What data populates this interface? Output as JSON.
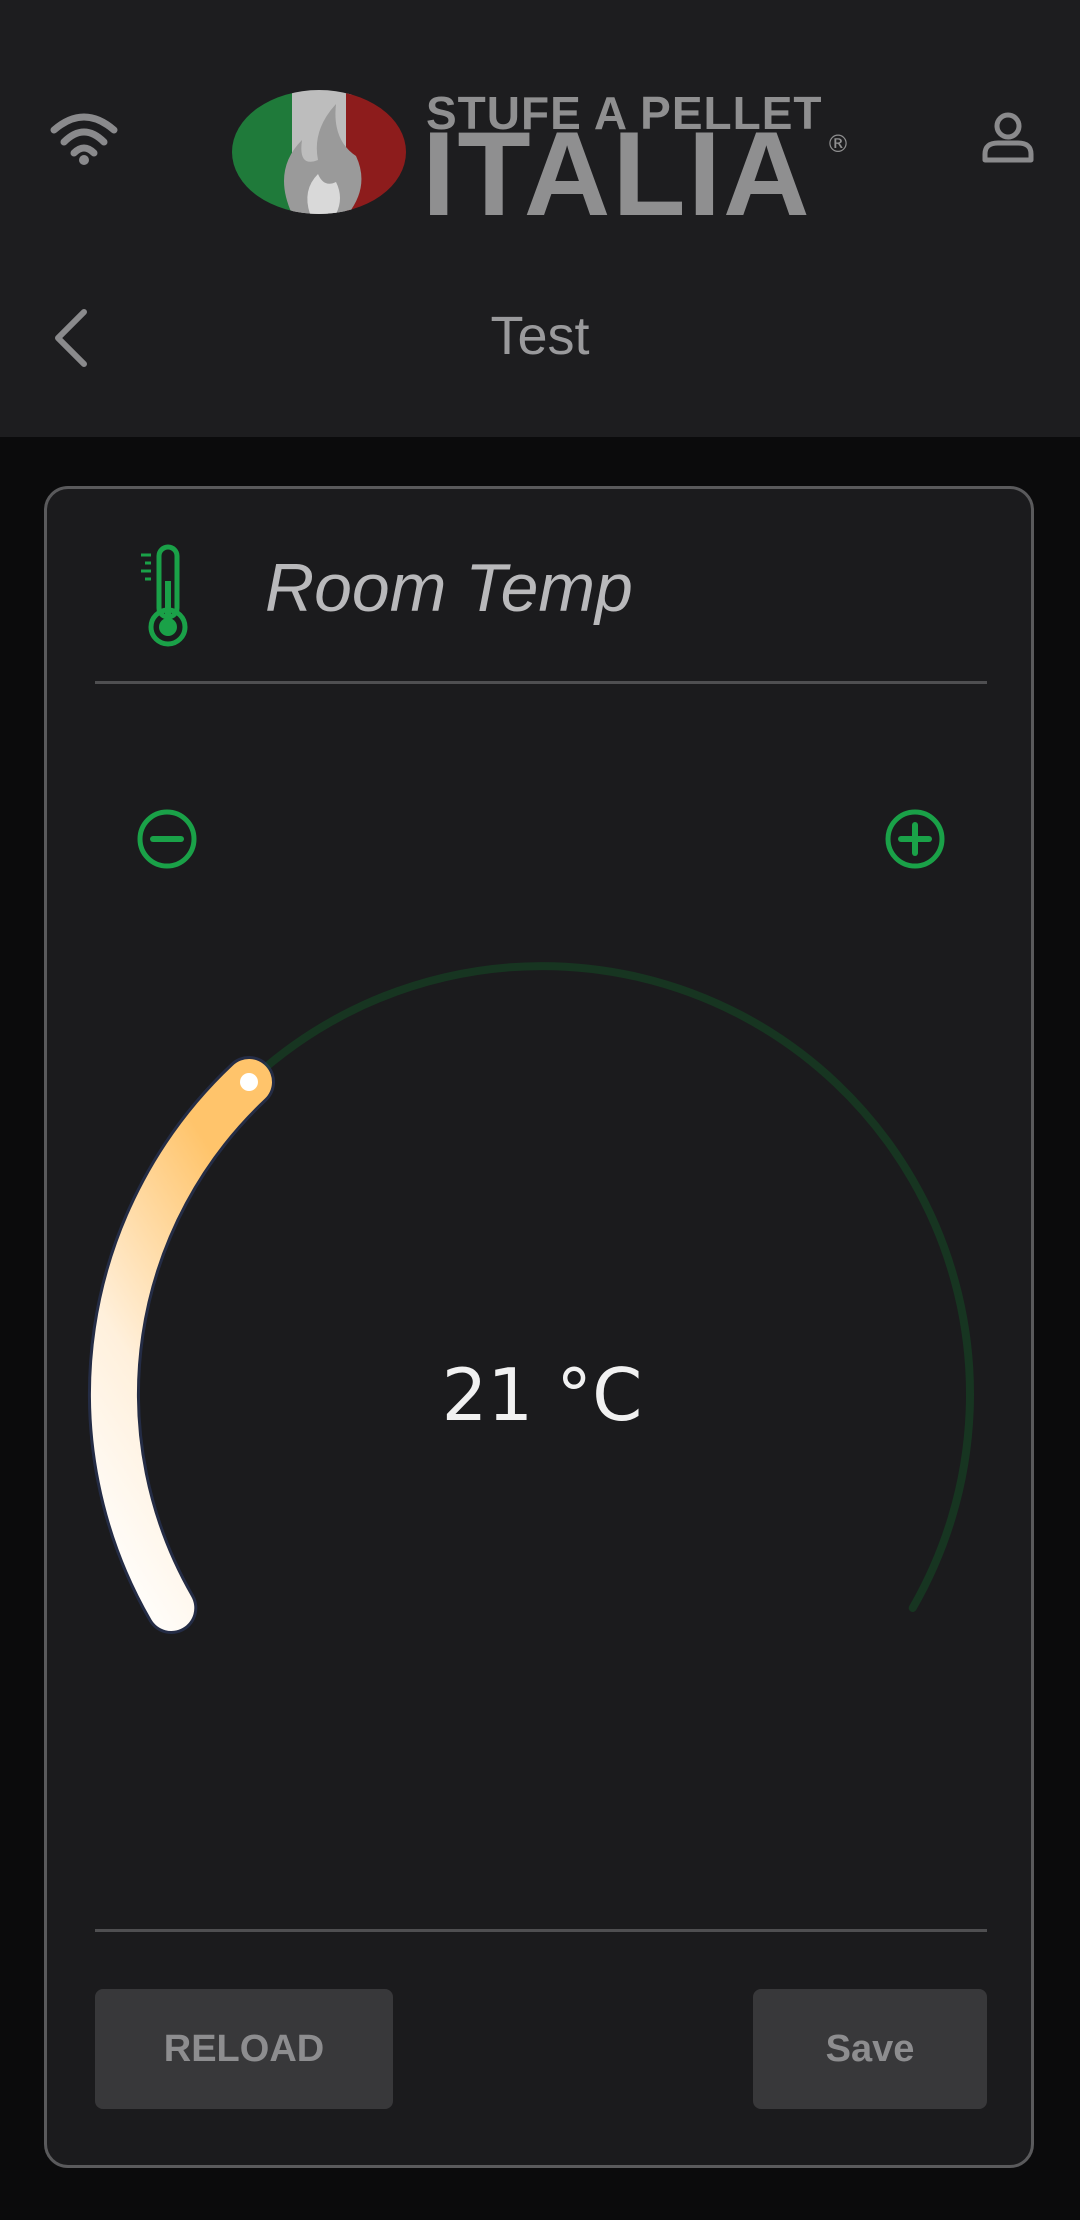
{
  "header": {
    "logo": {
      "line1": "STUFE A PELLET",
      "line2": "ITALIA",
      "reg": "®",
      "colors": {
        "green": "#1f7a3a",
        "red": "#8d1c1c",
        "text": "#8f8f90"
      }
    },
    "icons": {
      "left": "wifi-icon",
      "right": "user-icon",
      "back": "chevron-left-icon"
    },
    "page_title": "Test"
  },
  "card": {
    "icon": "thermometer-icon",
    "title": "Room Temp",
    "setpoint": {
      "display": "21 °C",
      "value": 21,
      "unit": "°C",
      "fill_fraction": 0.32
    },
    "controls": {
      "decrement_icon": "minus-circle-icon",
      "increment_icon": "plus-circle-icon"
    },
    "buttons": {
      "reload": "RELOAD",
      "save": "Save"
    }
  },
  "colors": {
    "accent_green": "#1aa148",
    "track_green": "#173521",
    "arc_start": "#ffffff",
    "arc_end": "#ffc46b",
    "background": "#0b0b0c",
    "header": "#1d1d1f",
    "card": "#1b1b1d"
  }
}
